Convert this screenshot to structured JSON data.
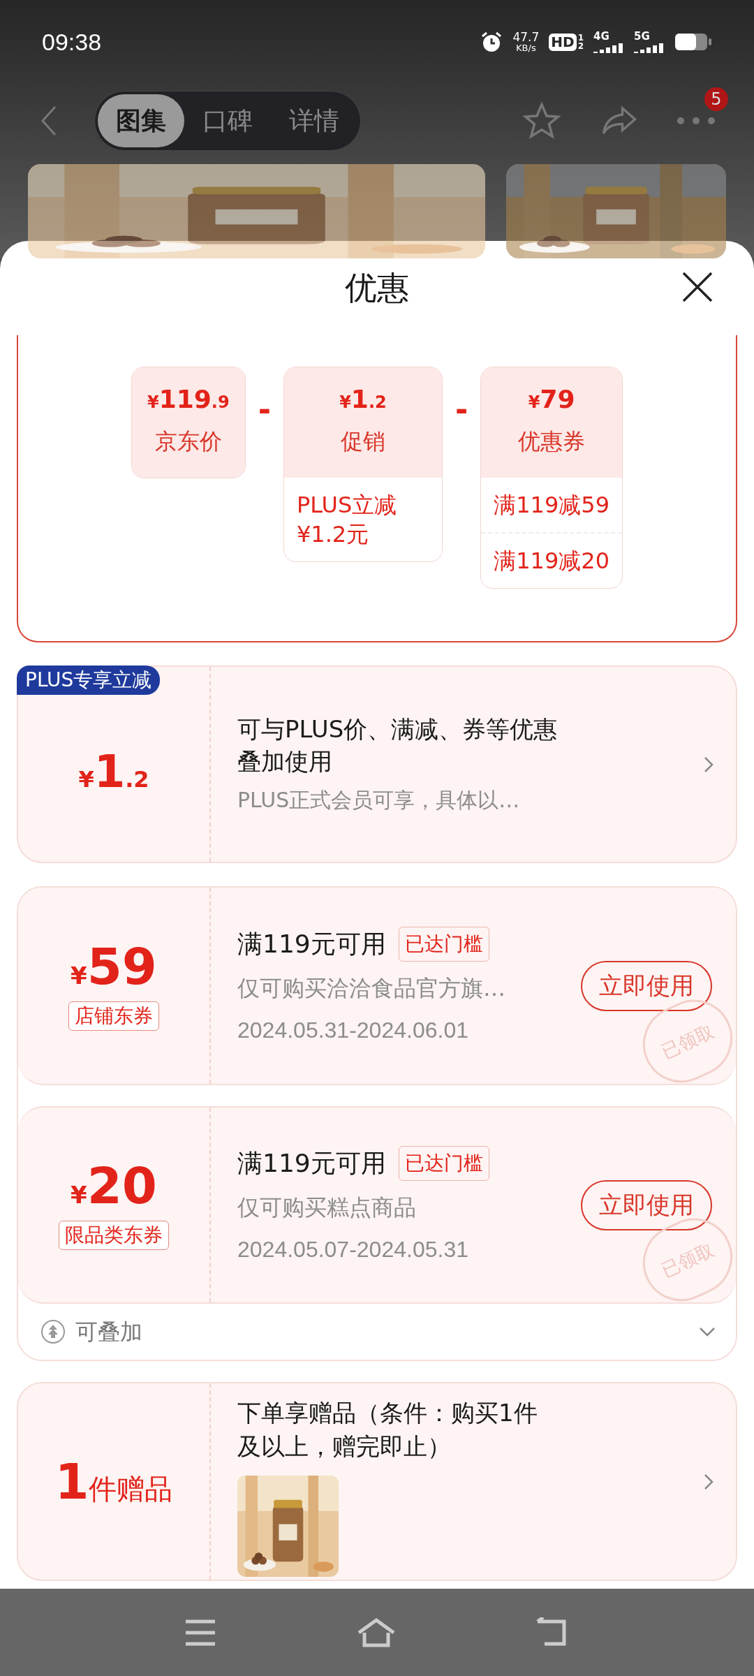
{
  "status_bar": {
    "time": "09:38",
    "speed_value": "47.7",
    "speed_unit": "KB/s",
    "hd": "HD",
    "hd_sims": [
      "1",
      "2"
    ],
    "networks": [
      "4G",
      "5G"
    ]
  },
  "top_nav": {
    "tabs": [
      {
        "label": "图集",
        "selected": true
      },
      {
        "label": "口碑",
        "selected": false
      },
      {
        "label": "详情",
        "selected": false
      }
    ],
    "badge": "5"
  },
  "sheet": {
    "title": "优惠"
  },
  "breakdown": {
    "items": [
      {
        "currency": "¥",
        "integer": "119",
        "decimal": ".9",
        "label": "京东价"
      },
      {
        "currency": "¥",
        "integer": "1",
        "decimal": ".2",
        "label": "促销",
        "details": [
          "PLUS立减 ¥1.2元"
        ]
      },
      {
        "currency": "¥",
        "integer": "79",
        "label": "优惠券",
        "details": [
          "满119减59",
          "满119减20"
        ]
      }
    ],
    "operators": [
      "-",
      "-"
    ]
  },
  "plus_card": {
    "badge": "PLUS专享立减",
    "currency": "¥",
    "integer": "1",
    "decimal": ".2",
    "title": "可与PLUS价、满减、券等优惠叠加使用",
    "subtitle": "PLUS正式会员可享，具体以…"
  },
  "coupons": [
    {
      "currency": "¥",
      "amount": "59",
      "type": "店铺东券",
      "condition": "满119元可用",
      "tag": "已达门槛",
      "scope": "仅可购买洽洽食品官方旗…",
      "dates": "2024.05.31-2024.06.01",
      "button": "立即使用",
      "claimed": true,
      "stamp": "已领取"
    },
    {
      "currency": "¥",
      "amount": "20",
      "type": "限品类东券",
      "condition": "满119元可用",
      "tag": "已达门槛",
      "scope": "仅可购买糕点商品",
      "dates": "2024.05.07-2024.05.31",
      "button": "立即使用",
      "claimed": true,
      "stamp": "已领取"
    }
  ],
  "stack_footer": {
    "label": "可叠加",
    "expanded": false
  },
  "gift": {
    "count": "1",
    "unit": "件赠品",
    "title": "下单享赠品（条件：购买1件及以上，赠完即止）"
  }
}
